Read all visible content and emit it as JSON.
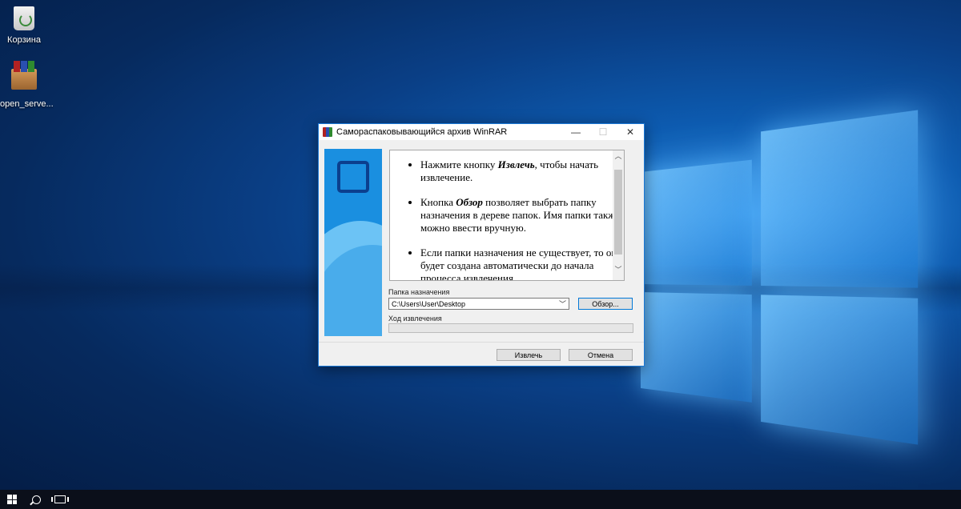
{
  "desktop": {
    "icons": [
      {
        "label": "Корзина",
        "icon": "recycle-bin-icon"
      },
      {
        "label": "open_serve...",
        "icon": "winrar-archive-icon"
      }
    ]
  },
  "dialog": {
    "title": "Самораспаковывающийся архив WinRAR",
    "controls": {
      "minimize": "—",
      "maximize": "☐",
      "close": "✕"
    },
    "instructions": [
      {
        "before": "Нажмите кнопку ",
        "em": "Извлечь",
        "after": ", чтобы начать извлечение."
      },
      {
        "before": "Кнопка ",
        "em": "Обзор",
        "after": " позволяет выбрать папку назначения в дереве папок. Имя папки также можно ввести вручную."
      },
      {
        "before": "",
        "em": "",
        "after": "Если папки назначения не существует, то она будет создана автоматически до начала процесса извлечения."
      }
    ],
    "destination_label": "Папка назначения",
    "destination_value": "C:\\Users\\User\\Desktop",
    "browse_label": "Обзор...",
    "progress_label": "Ход извлечения",
    "progress": 0,
    "extract_label": "Извлечь",
    "cancel_label": "Отмена"
  },
  "colors": {
    "accent": "#0078d7",
    "panel_blue": "#1a8fe0"
  }
}
